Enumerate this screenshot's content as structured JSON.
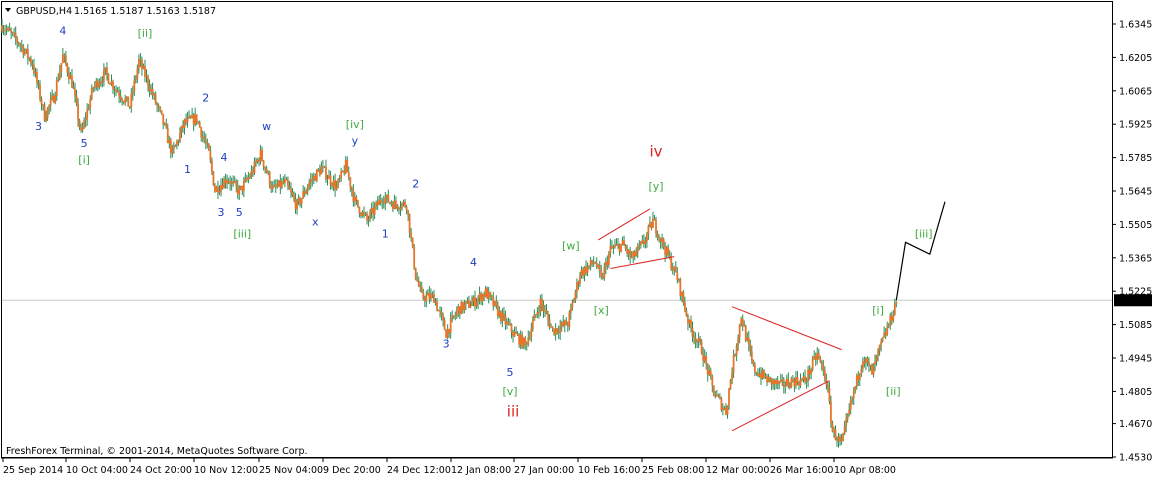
{
  "header": {
    "symbol": "GBPUSD,H4",
    "ohlc": "1.5165 1.5187 1.5163 1.5187"
  },
  "copyright": "FreshForex Terminal, © 2001-2014, MetaQuotes Software Corp.",
  "colors": {
    "background": "#ffffff",
    "candle": "#e8742a",
    "wick": "#2e8b57",
    "blue_wave": "#1f3fbf",
    "green_wave": "#3daa3d",
    "red_wave": "#dd2222",
    "triangle": "#dd2222",
    "projection": "#000000",
    "price_box": "#000000",
    "price_box_text": "#ffffff"
  },
  "chart_data": {
    "type": "line",
    "title": "GBPUSD,H4",
    "y_axis": {
      "side": "right",
      "ylim": [
        1.453,
        1.639
      ],
      "ticks": [
        "1.6345",
        "1.6205",
        "1.6065",
        "1.5925",
        "1.5785",
        "1.5645",
        "1.5505",
        "1.5365",
        "1.5225",
        "1.5085",
        "1.4945",
        "1.4805",
        "1.4670",
        "1.4530"
      ]
    },
    "x_axis": {
      "ticks": [
        "25 Sep 2014",
        "10 Oct 04:00",
        "24 Oct 20:00",
        "10 Nov 12:00",
        "25 Nov 04:00",
        "9 Dec 20:00",
        "24 Dec 12:00",
        "12 Jan 08:00",
        "27 Jan 00:00",
        "10 Feb 16:00",
        "25 Feb 08:00",
        "12 Mar 00:00",
        "26 Mar 16:00",
        "10 Apr 08:00"
      ]
    },
    "current_price": "1.5187",
    "price_path": [
      [
        0,
        1.634
      ],
      [
        3,
        1.63
      ],
      [
        6,
        1.626
      ],
      [
        10,
        1.618
      ],
      [
        14,
        1.596
      ],
      [
        17,
        1.604
      ],
      [
        20,
        1.621
      ],
      [
        23,
        1.61
      ],
      [
        26,
        1.588
      ],
      [
        30,
        1.608
      ],
      [
        34,
        1.614
      ],
      [
        37,
        1.608
      ],
      [
        42,
        1.6
      ],
      [
        45,
        1.619
      ],
      [
        48,
        1.61
      ],
      [
        53,
        1.593
      ],
      [
        56,
        1.58
      ],
      [
        60,
        1.593
      ],
      [
        64,
        1.595
      ],
      [
        68,
        1.58
      ],
      [
        70,
        1.565
      ],
      [
        74,
        1.57
      ],
      [
        78,
        1.564
      ],
      [
        82,
        1.572
      ],
      [
        85,
        1.58
      ],
      [
        89,
        1.565
      ],
      [
        93,
        1.568
      ],
      [
        97,
        1.558
      ],
      [
        101,
        1.568
      ],
      [
        105,
        1.574
      ],
      [
        110,
        1.566
      ],
      [
        113,
        1.575
      ],
      [
        116,
        1.56
      ],
      [
        120,
        1.552
      ],
      [
        125,
        1.562
      ],
      [
        129,
        1.559
      ],
      [
        133,
        1.559
      ],
      [
        136,
        1.529
      ],
      [
        138,
        1.52
      ],
      [
        142,
        1.52
      ],
      [
        146,
        1.505
      ],
      [
        150,
        1.515
      ],
      [
        155,
        1.518
      ],
      [
        159,
        1.522
      ],
      [
        164,
        1.512
      ],
      [
        168,
        1.505
      ],
      [
        172,
        1.5
      ],
      [
        177,
        1.518
      ],
      [
        181,
        1.506
      ],
      [
        186,
        1.509
      ],
      [
        190,
        1.53
      ],
      [
        195,
        1.535
      ],
      [
        197,
        1.527
      ],
      [
        200,
        1.54
      ],
      [
        204,
        1.542
      ],
      [
        207,
        1.536
      ],
      [
        211,
        1.543
      ],
      [
        214,
        1.552
      ],
      [
        218,
        1.54
      ],
      [
        222,
        1.528
      ],
      [
        226,
        1.508
      ],
      [
        230,
        1.498
      ],
      [
        234,
        1.48
      ],
      [
        238,
        1.472
      ],
      [
        240,
        1.49
      ],
      [
        243,
        1.512
      ],
      [
        247,
        1.49
      ],
      [
        252,
        1.485
      ],
      [
        256,
        1.483
      ],
      [
        260,
        1.485
      ],
      [
        264,
        1.485
      ],
      [
        268,
        1.496
      ],
      [
        271,
        1.485
      ],
      [
        273,
        1.464
      ],
      [
        276,
        1.458
      ],
      [
        279,
        1.475
      ],
      [
        283,
        1.495
      ],
      [
        286,
        1.488
      ],
      [
        289,
        1.5
      ],
      [
        292,
        1.51
      ],
      [
        294,
        1.5187
      ]
    ],
    "projection_path": [
      [
        294,
        1.5187
      ],
      [
        297,
        1.543
      ],
      [
        305,
        1.538
      ],
      [
        310,
        1.56
      ]
    ],
    "triangles": [
      [
        [
          196,
          1.544
        ],
        [
          213,
          1.557
        ],
        [
          221,
          1.537
        ],
        [
          200,
          1.532
        ]
      ],
      [
        [
          240,
          1.516
        ],
        [
          276,
          1.498
        ],
        [
          272,
          1.485
        ],
        [
          240,
          1.464
        ]
      ]
    ],
    "wave_labels": [
      {
        "text": "3",
        "color": "blue",
        "t": 12,
        "price": 1.59
      },
      {
        "text": "4",
        "color": "blue",
        "t": 20,
        "price": 1.63
      },
      {
        "text": "5",
        "color": "blue",
        "t": 27,
        "price": 1.583
      },
      {
        "text": "[i]",
        "color": "green",
        "t": 27,
        "price": 1.576
      },
      {
        "text": "[ii]",
        "color": "green",
        "t": 47,
        "price": 1.629
      },
      {
        "text": "2",
        "color": "blue",
        "t": 67,
        "price": 1.602
      },
      {
        "text": "1",
        "color": "blue",
        "t": 61,
        "price": 1.572
      },
      {
        "text": "4",
        "color": "blue",
        "t": 73,
        "price": 1.577
      },
      {
        "text": "w",
        "color": "blue",
        "t": 87,
        "price": 1.59
      },
      {
        "text": "3",
        "color": "blue",
        "t": 72,
        "price": 1.554
      },
      {
        "text": "5",
        "color": "blue",
        "t": 78,
        "price": 1.554
      },
      {
        "text": "[iii]",
        "color": "green",
        "t": 79,
        "price": 1.545
      },
      {
        "text": "x",
        "color": "blue",
        "t": 103,
        "price": 1.55
      },
      {
        "text": "[iv]",
        "color": "green",
        "t": 116,
        "price": 1.591
      },
      {
        "text": "y",
        "color": "blue",
        "t": 116,
        "price": 1.584
      },
      {
        "text": "2",
        "color": "blue",
        "t": 136,
        "price": 1.566
      },
      {
        "text": "1",
        "color": "blue",
        "t": 126,
        "price": 1.545
      },
      {
        "text": "4",
        "color": "blue",
        "t": 155,
        "price": 1.533
      },
      {
        "text": "3",
        "color": "blue",
        "t": 146,
        "price": 1.499
      },
      {
        "text": "5",
        "color": "blue",
        "t": 167,
        "price": 1.487
      },
      {
        "text": "[v]",
        "color": "green",
        "t": 167,
        "price": 1.479
      },
      {
        "text": "iii",
        "color": "red",
        "t": 168,
        "price": 1.47
      },
      {
        "text": "[w]",
        "color": "green",
        "t": 187,
        "price": 1.54
      },
      {
        "text": "[x]",
        "color": "green",
        "t": 197,
        "price": 1.513
      },
      {
        "text": "iv",
        "color": "red",
        "t": 215,
        "price": 1.579
      },
      {
        "text": "[y]",
        "color": "green",
        "t": 215,
        "price": 1.565
      },
      {
        "text": "[i]",
        "color": "green",
        "t": 288,
        "price": 1.513
      },
      {
        "text": "[ii]",
        "color": "green",
        "t": 293,
        "price": 1.479
      },
      {
        "text": "[iii]",
        "color": "green",
        "t": 303,
        "price": 1.545
      }
    ]
  }
}
